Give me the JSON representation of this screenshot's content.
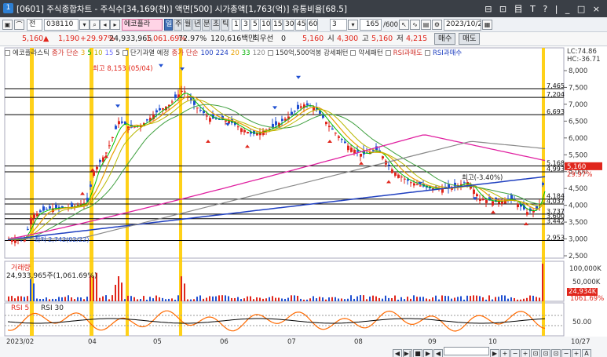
{
  "window": {
    "number": "1",
    "title": "[0601] 주식종합차트 - 주식수[34,169(천)]  액면[500]  시가총액[1,763(억)]  유통비율[68.5]",
    "controls": "⊟ ⊡ 目 T ? | _ □ ×"
  },
  "toolbar": {
    "market": "전",
    "code": "038110",
    "stock_name": "에코플라",
    "period_buttons": [
      "일",
      "주",
      "월",
      "년",
      "분",
      "초",
      "틱"
    ],
    "minute_buttons": [
      "1",
      "3",
      "5",
      "10",
      "15",
      "30",
      "45",
      "60"
    ],
    "interval_value": "3",
    "count_value": "165",
    "count_total": "/600",
    "date_value": "2023/10/27"
  },
  "quote": {
    "price": "5,160",
    "change": "1,190",
    "change_pct": "+29.97%",
    "volume": "24,933,965",
    "volume_pct": "1,061.69%",
    "turnover": "72.97%",
    "amount": "120,616백만",
    "priority_label": "최우선",
    "priority_value": "0",
    "price2": "5,160",
    "open_label": "시",
    "open": "4,300",
    "high_label": "고",
    "high": "5,160",
    "low_label": "저",
    "low": "4,215",
    "buy_label": "매수",
    "sell_label": "매도"
  },
  "legend": {
    "items": [
      {
        "label": "에코플라스틱",
        "color": "#333333"
      },
      {
        "label": "종가 단순",
        "color": "#d0302a"
      },
      {
        "label": "3",
        "color": "#e8a000"
      },
      {
        "label": "5",
        "color": "#00b000"
      },
      {
        "label": "10",
        "color": "#b0b000"
      },
      {
        "label": "15",
        "color": "#7070ff"
      },
      {
        "label": "5",
        "color": "#333333"
      },
      {
        "label": "단기과열 예정",
        "color": "#333333"
      },
      {
        "label": "종가 단순",
        "color": "#d0302a"
      },
      {
        "label": "100",
        "color": "#2040c0"
      },
      {
        "label": "224",
        "color": "#2040c0"
      },
      {
        "label": "20",
        "color": "#e8a000"
      },
      {
        "label": "33",
        "color": "#00b000"
      },
      {
        "label": "120",
        "color": "#888888"
      },
      {
        "label": "150억,500억봉 강세패턴",
        "color": "#333333"
      },
      {
        "label": "약세패턴",
        "color": "#333333"
      },
      {
        "label": "RSI과매도",
        "color": "#d0302a"
      },
      {
        "label": "RSI과매수",
        "color": "#2040c0"
      }
    ]
  },
  "annotations": {
    "high_label": "최고 8,153 (05/04)",
    "low_label": "최저 2,742(02/22)",
    "last_peak_label": "최고(-3.40%)"
  },
  "price_axis": {
    "header_lc": "LC:74.86",
    "header_hc": "HC:-36.71",
    "ticks": [
      "8,000",
      "7,500",
      "7,000",
      "6,500",
      "6,000",
      "5,500",
      "5,000",
      "4,500",
      "4,000",
      "3,500",
      "3,000",
      "2,500"
    ],
    "levels": [
      "7,465",
      "7,204",
      "6,693",
      "5,168",
      "4,993",
      "4,184",
      "4,037",
      "3,737",
      "3,600",
      "3,442",
      "2,953"
    ],
    "current_tag": "5,160",
    "current_pct": "29.97%"
  },
  "volume_pane": {
    "label": "거래량",
    "value": "24,933,965주(1,061.69%)",
    "axis_top": "100,000K",
    "axis_mid": "50,000K",
    "current_tag": "24,934K",
    "current_pct": "1061.69%"
  },
  "rsi_pane": {
    "label": "RSI 5",
    "label2": "RSI 30",
    "axis_mid": "50.00"
  },
  "date_axis": {
    "labels": [
      "2023/02",
      "04",
      "05",
      "06",
      "07",
      "08",
      "09",
      "10"
    ],
    "end_label": "10/27"
  },
  "navbar": [
    "◀",
    "▶|",
    "■",
    "▶",
    "◀",
    "▶",
    "+",
    "−",
    "+",
    "⊡",
    "⊡",
    "⊡",
    "−",
    "+",
    "A"
  ],
  "colors": {
    "up": "#e0261c",
    "down": "#1f4fd1",
    "highlight_bar": "#ffcc00",
    "ma_long": "#2040c0",
    "ma_magenta": "#e020a0",
    "ma_gray": "#888888"
  }
}
